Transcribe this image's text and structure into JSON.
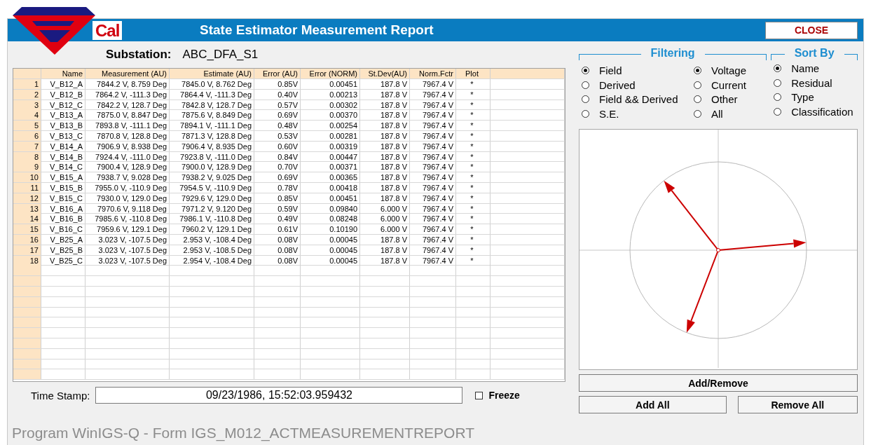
{
  "window": {
    "logo_text": "Cal",
    "title": "State Estimator Measurement Report",
    "close_button": "CLOSE"
  },
  "substation": {
    "label": "Substation:",
    "value": "ABC_DFA_S1"
  },
  "table": {
    "columns": [
      "Name",
      "Measurement (AU)",
      "Estimate (AU)",
      "Error (AU)",
      "Error (NORM)",
      "St.Dev(AU)",
      "Norm.Fctr",
      "Plot"
    ],
    "rows": [
      {
        "index": "1",
        "cells": [
          "V_B12_A",
          "7844.2 V, 8.759 Deg",
          "7845.0 V, 8.762 Deg",
          "0.85V",
          "0.00451",
          "187.8 V",
          "7967.4 V",
          "*"
        ]
      },
      {
        "index": "2",
        "cells": [
          "V_B12_B",
          "7864.2 V, -111.3 Deg",
          "7864.4 V, -111.3 Deg",
          "0.40V",
          "0.00213",
          "187.8 V",
          "7967.4 V",
          "*"
        ]
      },
      {
        "index": "3",
        "cells": [
          "V_B12_C",
          "7842.2 V, 128.7 Deg",
          "7842.8 V, 128.7 Deg",
          "0.57V",
          "0.00302",
          "187.8 V",
          "7967.4 V",
          "*"
        ]
      },
      {
        "index": "4",
        "cells": [
          "V_B13_A",
          "7875.0 V, 8.847 Deg",
          "7875.6 V, 8.849 Deg",
          "0.69V",
          "0.00370",
          "187.8 V",
          "7967.4 V",
          "*"
        ]
      },
      {
        "index": "5",
        "cells": [
          "V_B13_B",
          "7893.8 V, -111.1 Deg",
          "7894.1 V, -111.1 Deg",
          "0.48V",
          "0.00254",
          "187.8 V",
          "7967.4 V",
          "*"
        ]
      },
      {
        "index": "6",
        "cells": [
          "V_B13_C",
          "7870.8 V, 128.8 Deg",
          "7871.3 V, 128.8 Deg",
          "0.53V",
          "0.00281",
          "187.8 V",
          "7967.4 V",
          "*"
        ]
      },
      {
        "index": "7",
        "cells": [
          "V_B14_A",
          "7906.9 V, 8.938 Deg",
          "7906.4 V, 8.935 Deg",
          "0.60V",
          "0.00319",
          "187.8 V",
          "7967.4 V",
          "*"
        ]
      },
      {
        "index": "8",
        "cells": [
          "V_B14_B",
          "7924.4 V, -111.0 Deg",
          "7923.8 V, -111.0 Deg",
          "0.84V",
          "0.00447",
          "187.8 V",
          "7967.4 V",
          "*"
        ]
      },
      {
        "index": "9",
        "cells": [
          "V_B14_C",
          "7900.4 V, 128.9 Deg",
          "7900.0 V, 128.9 Deg",
          "0.70V",
          "0.00371",
          "187.8 V",
          "7967.4 V",
          "*"
        ]
      },
      {
        "index": "10",
        "cells": [
          "V_B15_A",
          "7938.7 V, 9.028 Deg",
          "7938.2 V, 9.025 Deg",
          "0.69V",
          "0.00365",
          "187.8 V",
          "7967.4 V",
          "*"
        ]
      },
      {
        "index": "11",
        "cells": [
          "V_B15_B",
          "7955.0 V, -110.9 Deg",
          "7954.5 V, -110.9 Deg",
          "0.78V",
          "0.00418",
          "187.8 V",
          "7967.4 V",
          "*"
        ]
      },
      {
        "index": "12",
        "cells": [
          "V_B15_C",
          "7930.0 V, 129.0 Deg",
          "7929.6 V, 129.0 Deg",
          "0.85V",
          "0.00451",
          "187.8 V",
          "7967.4 V",
          "*"
        ]
      },
      {
        "index": "13",
        "cells": [
          "V_B16_A",
          "7970.6 V, 9.118 Deg",
          "7971.2 V, 9.120 Deg",
          "0.59V",
          "0.09840",
          "6.000 V",
          "7967.4 V",
          "*"
        ]
      },
      {
        "index": "14",
        "cells": [
          "V_B16_B",
          "7985.6 V, -110.8 Deg",
          "7986.1 V, -110.8 Deg",
          "0.49V",
          "0.08248",
          "6.000 V",
          "7967.4 V",
          "*"
        ]
      },
      {
        "index": "15",
        "cells": [
          "V_B16_C",
          "7959.6 V, 129.1 Deg",
          "7960.2 V, 129.1 Deg",
          "0.61V",
          "0.10190",
          "6.000 V",
          "7967.4 V",
          "*"
        ]
      },
      {
        "index": "16",
        "cells": [
          "V_B25_A",
          "3.023 V, -107.5 Deg",
          "2.953 V, -108.4 Deg",
          "0.08V",
          "0.00045",
          "187.8 V",
          "7967.4 V",
          "*"
        ]
      },
      {
        "index": "17",
        "cells": [
          "V_B25_B",
          "3.023 V, -107.5 Deg",
          "2.953 V, -108.5 Deg",
          "0.08V",
          "0.00045",
          "187.8 V",
          "7967.4 V",
          "*"
        ]
      },
      {
        "index": "18",
        "cells": [
          "V_B25_C",
          "3.023 V, -107.5 Deg",
          "2.954 V, -108.4 Deg",
          "0.08V",
          "0.00045",
          "187.8 V",
          "7967.4 V",
          "*"
        ]
      }
    ]
  },
  "timestamp": {
    "label": "Time Stamp:",
    "value": "09/23/1986, 15:52:03.959432"
  },
  "freeze": {
    "label": "Freeze",
    "checked": false
  },
  "filtering": {
    "title": "Filtering",
    "source": [
      {
        "label": "Field",
        "selected": true
      },
      {
        "label": "Derived",
        "selected": false
      },
      {
        "label": "Field && Derived",
        "selected": false
      },
      {
        "label": "S.E.",
        "selected": false
      }
    ],
    "type": [
      {
        "label": "Voltage",
        "selected": true
      },
      {
        "label": "Current",
        "selected": false
      },
      {
        "label": "Other",
        "selected": false
      },
      {
        "label": "All",
        "selected": false
      }
    ]
  },
  "sort_by": {
    "title": "Sort By",
    "options": [
      {
        "label": "Name",
        "selected": true
      },
      {
        "label": "Residual",
        "selected": false
      },
      {
        "label": "Type",
        "selected": false
      },
      {
        "label": "Classification",
        "selected": false
      }
    ]
  },
  "buttons": {
    "add_remove": "Add/Remove",
    "add_all": "Add All",
    "remove_all": "Remove All"
  },
  "footer": "Program WinIGS-Q - Form IGS_M012_ACTMEASUREMENTREPORT"
}
